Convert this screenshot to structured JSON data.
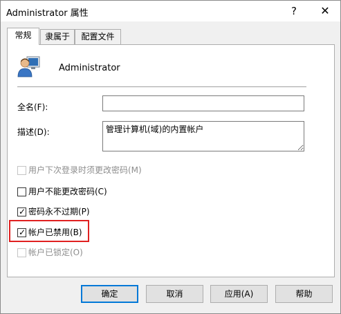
{
  "window": {
    "title": "Administrator 属性",
    "help_glyph": "?",
    "close_glyph": "✕"
  },
  "tabs": [
    {
      "label": "常规",
      "active": true
    },
    {
      "label": "隶属于",
      "active": false
    },
    {
      "label": "配置文件",
      "active": false
    }
  ],
  "general": {
    "user_icon": "user-icon",
    "user_name": "Administrator",
    "fullname_label": "全名(F):",
    "fullname_value": "",
    "description_label": "描述(D):",
    "description_value": "管理计算机(域)的内置帐户"
  },
  "checkboxes": [
    {
      "label": "用户下次登录时须更改密码(M)",
      "checked": false,
      "disabled": true
    },
    {
      "label": "用户不能更改密码(C)",
      "checked": false,
      "disabled": false
    },
    {
      "label": "密码永不过期(P)",
      "checked": true,
      "disabled": false
    },
    {
      "label": "帐户已禁用(B)",
      "checked": true,
      "disabled": false
    },
    {
      "label": "帐户已锁定(O)",
      "checked": false,
      "disabled": true
    }
  ],
  "buttons": {
    "ok": "确定",
    "cancel": "取消",
    "apply": "应用(A)",
    "help": "帮助"
  },
  "colors": {
    "highlight": "#e02020",
    "default_button_border": "#0078d7"
  }
}
